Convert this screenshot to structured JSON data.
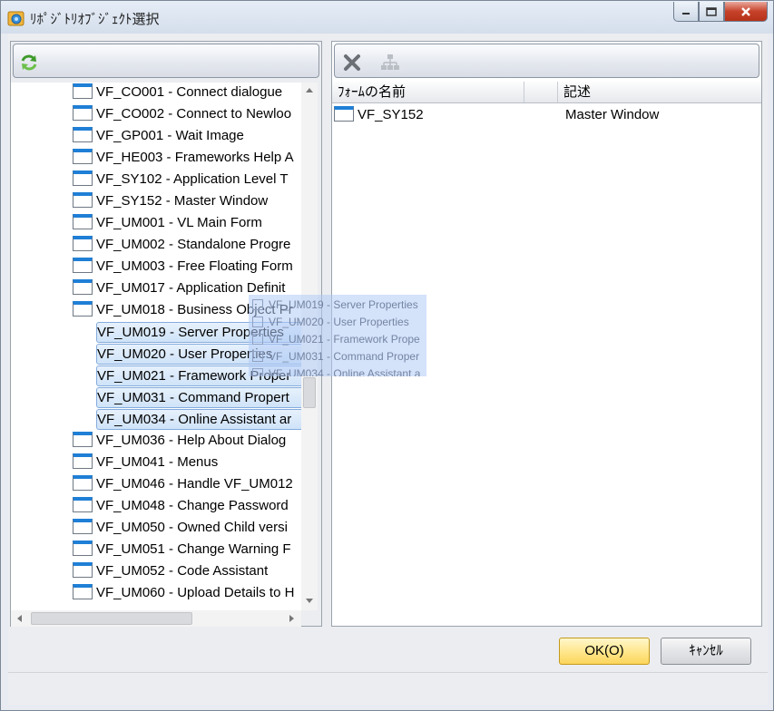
{
  "window": {
    "title": "ﾘﾎﾟｼﾞﾄﾘｵﾌﾞｼﾞｪｸﾄ選択"
  },
  "left_toolbar": {
    "refresh_icon": "refresh-icon"
  },
  "right_toolbar": {
    "delete_icon": "delete-x-icon",
    "hierarchy_icon": "hierarchy-icon"
  },
  "tree": {
    "items": [
      {
        "label": "VF_CO001 - Connect dialogue",
        "selected": false
      },
      {
        "label": "VF_CO002 - Connect to Newloo",
        "selected": false
      },
      {
        "label": "VF_GP001 - Wait Image",
        "selected": false
      },
      {
        "label": "VF_HE003 - Frameworks Help A",
        "selected": false
      },
      {
        "label": "VF_SY102 - Application Level T",
        "selected": false
      },
      {
        "label": "VF_SY152 - Master Window",
        "selected": false
      },
      {
        "label": "VF_UM001 - VL Main Form",
        "selected": false
      },
      {
        "label": "VF_UM002 - Standalone Progre",
        "selected": false
      },
      {
        "label": "VF_UM003 - Free Floating Form",
        "selected": false
      },
      {
        "label": "VF_UM017 - Application Definit",
        "selected": false
      },
      {
        "label": "VF_UM018 - Business Object Pr",
        "selected": false
      },
      {
        "label": "VF_UM019 - Server Properties",
        "selected": true
      },
      {
        "label": "VF_UM020 - User Properties",
        "selected": true
      },
      {
        "label": "VF_UM021 - Framework Proper",
        "selected": true
      },
      {
        "label": "VF_UM031 - Command Propert",
        "selected": true
      },
      {
        "label": "VF_UM034 - Online Assistant ar",
        "selected": true
      },
      {
        "label": "VF_UM036 - Help About Dialog",
        "selected": false
      },
      {
        "label": "VF_UM041 - Menus",
        "selected": false
      },
      {
        "label": "VF_UM046 - Handle VF_UM012",
        "selected": false
      },
      {
        "label": "VF_UM048 - Change Password",
        "selected": false
      },
      {
        "label": "VF_UM050 - Owned Child versi",
        "selected": false
      },
      {
        "label": "VF_UM051 - Change Warning F",
        "selected": false
      },
      {
        "label": "VF_UM052 - Code Assistant",
        "selected": false
      },
      {
        "label": "VF_UM060 - Upload Details to H",
        "selected": false
      }
    ]
  },
  "drag_ghost": {
    "items": [
      "VF_UM019 - Server Properties",
      "VF_UM020 - User Properties",
      "VF_UM021 - Framework Prope",
      "VF_UM031 - Command Proper",
      "VF_UM034 - Online Assistant a"
    ]
  },
  "list": {
    "columns": [
      "ﾌｫｰﾑの名前",
      "",
      "記述"
    ],
    "rows": [
      {
        "name": "VF_SY152",
        "description": "Master Window"
      }
    ]
  },
  "buttons": {
    "ok": "OK(O)",
    "cancel": "ｷｬﾝｾﾙ"
  },
  "colors": {
    "selection": "#cfe3f8",
    "selection_border": "#84acdd",
    "ok_button": "#ffe68a"
  }
}
